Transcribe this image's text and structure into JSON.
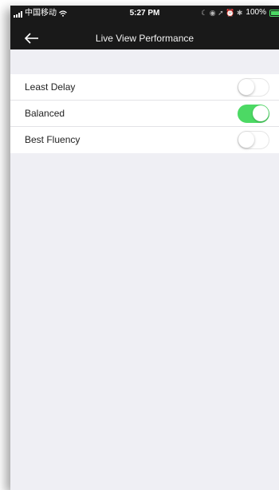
{
  "status_bar": {
    "carrier": "中国移动",
    "time": "5:27 PM",
    "status_icons": "☾ ◉ ➚ ⏰ ✱",
    "battery_percent": "100%",
    "battery_level": 1.0
  },
  "navbar": {
    "back_icon": "back-arrow-icon",
    "title": "Live View Performance"
  },
  "options": [
    {
      "label": "Least Delay",
      "enabled": false
    },
    {
      "label": "Balanced",
      "enabled": true
    },
    {
      "label": "Best Fluency",
      "enabled": false
    }
  ],
  "colors": {
    "bar_background": "#191919",
    "page_background": "#efeff4",
    "toggle_on": "#4cd964"
  }
}
